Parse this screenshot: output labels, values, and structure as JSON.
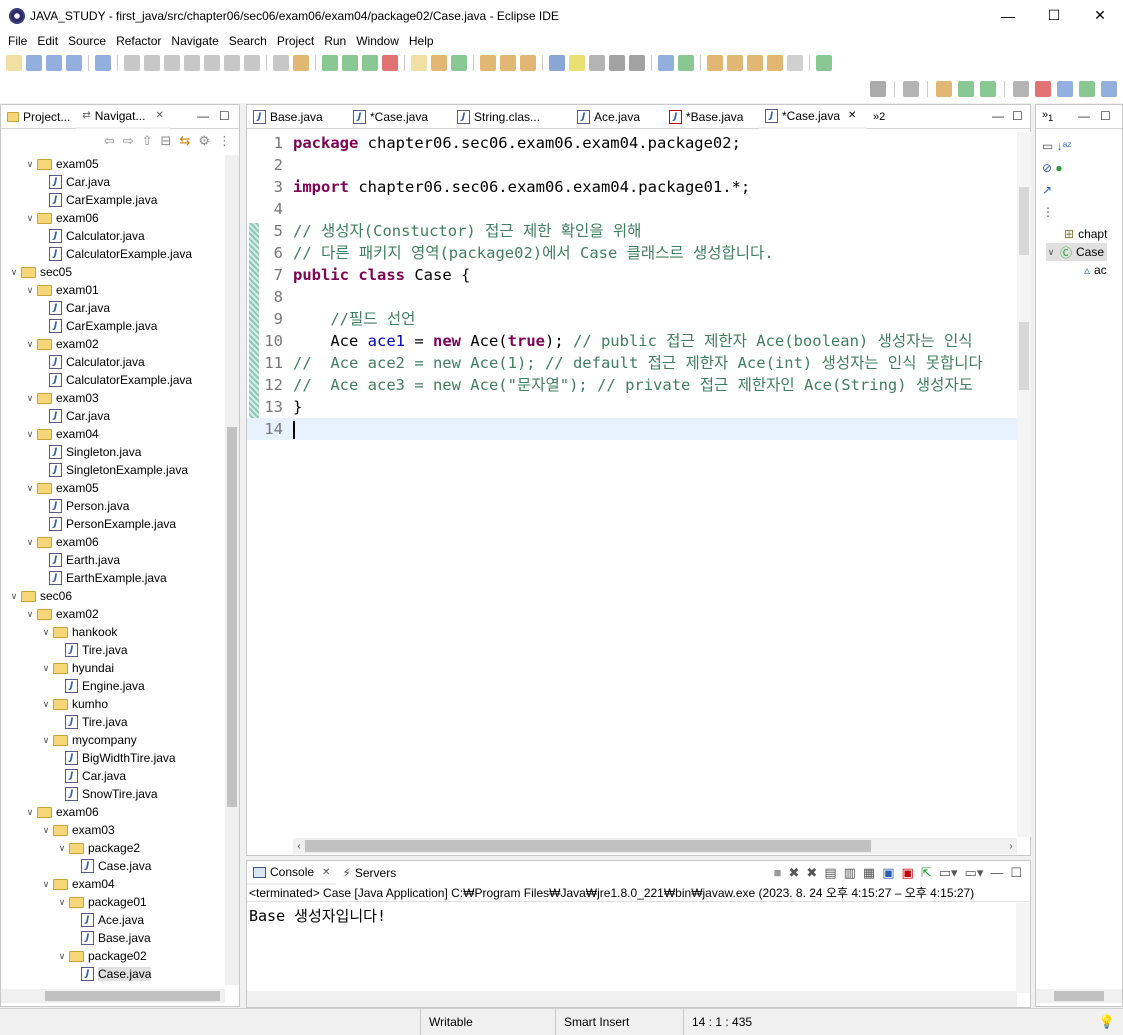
{
  "window": {
    "title": "JAVA_STUDY - first_java/src/chapter06/sec06/exam06/exam04/package02/Case.java - Eclipse IDE",
    "min": "—",
    "max": "☐",
    "close": "✕"
  },
  "menu": [
    "File",
    "Edit",
    "Source",
    "Refactor",
    "Navigate",
    "Search",
    "Project",
    "Run",
    "Window",
    "Help"
  ],
  "left_panel": {
    "tabs": [
      {
        "label": "Project..."
      },
      {
        "label": "Navigat..."
      }
    ],
    "close": "✕",
    "minimize": "—",
    "maximize": "☐"
  },
  "tree": [
    {
      "label": "exam05",
      "depth": 2,
      "type": "folder",
      "expanded": true
    },
    {
      "label": "Car.java",
      "depth": 3,
      "type": "file"
    },
    {
      "label": "CarExample.java",
      "depth": 3,
      "type": "file"
    },
    {
      "label": "exam06",
      "depth": 2,
      "type": "folder",
      "expanded": true
    },
    {
      "label": "Calculator.java",
      "depth": 3,
      "type": "file"
    },
    {
      "label": "CalculatorExample.java",
      "depth": 3,
      "type": "file"
    },
    {
      "label": "sec05",
      "depth": 1,
      "type": "folder",
      "expanded": true
    },
    {
      "label": "exam01",
      "depth": 2,
      "type": "folder",
      "expanded": true
    },
    {
      "label": "Car.java",
      "depth": 3,
      "type": "file"
    },
    {
      "label": "CarExample.java",
      "depth": 3,
      "type": "file"
    },
    {
      "label": "exam02",
      "depth": 2,
      "type": "folder",
      "expanded": true
    },
    {
      "label": "Calculator.java",
      "depth": 3,
      "type": "file"
    },
    {
      "label": "CalculatorExample.java",
      "depth": 3,
      "type": "file"
    },
    {
      "label": "exam03",
      "depth": 2,
      "type": "folder",
      "expanded": true
    },
    {
      "label": "Car.java",
      "depth": 3,
      "type": "file"
    },
    {
      "label": "exam04",
      "depth": 2,
      "type": "folder",
      "expanded": true
    },
    {
      "label": "Singleton.java",
      "depth": 3,
      "type": "file"
    },
    {
      "label": "SingletonExample.java",
      "depth": 3,
      "type": "file"
    },
    {
      "label": "exam05",
      "depth": 2,
      "type": "folder",
      "expanded": true
    },
    {
      "label": "Person.java",
      "depth": 3,
      "type": "file"
    },
    {
      "label": "PersonExample.java",
      "depth": 3,
      "type": "file"
    },
    {
      "label": "exam06",
      "depth": 2,
      "type": "folder",
      "expanded": true
    },
    {
      "label": "Earth.java",
      "depth": 3,
      "type": "file"
    },
    {
      "label": "EarthExample.java",
      "depth": 3,
      "type": "file"
    },
    {
      "label": "sec06",
      "depth": 1,
      "type": "folder",
      "expanded": true
    },
    {
      "label": "exam02",
      "depth": 2,
      "type": "folder",
      "expanded": true
    },
    {
      "label": "hankook",
      "depth": 3,
      "type": "folder",
      "expanded": true
    },
    {
      "label": "Tire.java",
      "depth": 4,
      "type": "file"
    },
    {
      "label": "hyundai",
      "depth": 3,
      "type": "folder",
      "expanded": true
    },
    {
      "label": "Engine.java",
      "depth": 4,
      "type": "file"
    },
    {
      "label": "kumho",
      "depth": 3,
      "type": "folder",
      "expanded": true
    },
    {
      "label": "Tire.java",
      "depth": 4,
      "type": "file"
    },
    {
      "label": "mycompany",
      "depth": 3,
      "type": "folder",
      "expanded": true
    },
    {
      "label": "BigWidthTire.java",
      "depth": 4,
      "type": "file"
    },
    {
      "label": "Car.java",
      "depth": 4,
      "type": "file"
    },
    {
      "label": "SnowTire.java",
      "depth": 4,
      "type": "file"
    },
    {
      "label": "exam06",
      "depth": 2,
      "type": "folder",
      "expanded": true
    },
    {
      "label": "exam03",
      "depth": 3,
      "type": "folder",
      "expanded": true
    },
    {
      "label": "package2",
      "depth": 4,
      "type": "folder",
      "expanded": true
    },
    {
      "label": "Case.java",
      "depth": 5,
      "type": "file"
    },
    {
      "label": "exam04",
      "depth": 3,
      "type": "folder",
      "expanded": true
    },
    {
      "label": "package01",
      "depth": 4,
      "type": "folder",
      "expanded": true
    },
    {
      "label": "Ace.java",
      "depth": 5,
      "type": "file"
    },
    {
      "label": "Base.java",
      "depth": 5,
      "type": "file"
    },
    {
      "label": "package02",
      "depth": 4,
      "type": "folder",
      "expanded": true
    },
    {
      "label": "Case.java",
      "depth": 5,
      "type": "file",
      "selected": true
    }
  ],
  "editor": {
    "tabs": [
      {
        "label": "Base.java"
      },
      {
        "label": "*Case.java"
      },
      {
        "label": "String.clas..."
      },
      {
        "label": "Ace.java"
      },
      {
        "label": "*Base.java"
      },
      {
        "label": "*Case.java",
        "active": true
      }
    ],
    "overflow": "»2",
    "close": "✕",
    "lines": [
      {
        "n": "1",
        "html": "<span class=\"kw\">package</span> chapter06.sec06.exam06.exam04.package02;"
      },
      {
        "n": "2",
        "html": ""
      },
      {
        "n": "3",
        "html": "<span class=\"kw\">import</span> chapter06.sec06.exam06.exam04.package01.*;"
      },
      {
        "n": "4",
        "html": ""
      },
      {
        "n": "5",
        "html": "<span class=\"cm\">// 생성자(Constuctor) 접근 제한 확인을 위해</span>"
      },
      {
        "n": "6",
        "html": "<span class=\"cm\">// 다른 패키지 영역(package02)에서 Case 클래스르 생성합니다.</span>"
      },
      {
        "n": "7",
        "html": "<span class=\"kw\">public</span> <span class=\"kw\">class</span> Case {"
      },
      {
        "n": "8",
        "html": ""
      },
      {
        "n": "9",
        "html": "    <span class=\"cm\">//필드 선언</span>"
      },
      {
        "n": "10",
        "html": "    Ace <span class=\"fld\">ace1</span> = <span class=\"kw\">new</span> Ace(<span class=\"kw\">true</span>); <span class=\"cm\">// public 접근 제한자 Ace(boolean) 생성자는 인식</span>"
      },
      {
        "n": "11",
        "html": "<span class=\"cm\">//  Ace ace2 = new Ace(1); // default 접근 제한자 Ace(int) 생성자는 인식 못합니다</span>"
      },
      {
        "n": "12",
        "html": "<span class=\"cm\">//  Ace ace3 = new Ace(\"문자열\"); // private 접근 제한자인 Ace(String) 생성자도</span>"
      },
      {
        "n": "13",
        "html": "}"
      },
      {
        "n": "14",
        "html": "",
        "current": true
      }
    ]
  },
  "right_panel": {
    "tab": "1",
    "outline": [
      {
        "label": "chapt"
      },
      {
        "label": "Case"
      },
      {
        "label": "ac"
      }
    ]
  },
  "console": {
    "tabs": [
      {
        "label": "Console",
        "active": true
      },
      {
        "label": "Servers"
      }
    ],
    "status": "<terminated> Case [Java Application] C:₩Program Files₩Java₩jre1.8.0_221₩bin₩javaw.exe  (2023. 8. 24 오후 4:15:27 – 오후 4:15:27)",
    "output": "Base 생성자입니다!"
  },
  "statusbar": {
    "writable": "Writable",
    "insert": "Smart Insert",
    "position": "14 : 1 : 435"
  }
}
